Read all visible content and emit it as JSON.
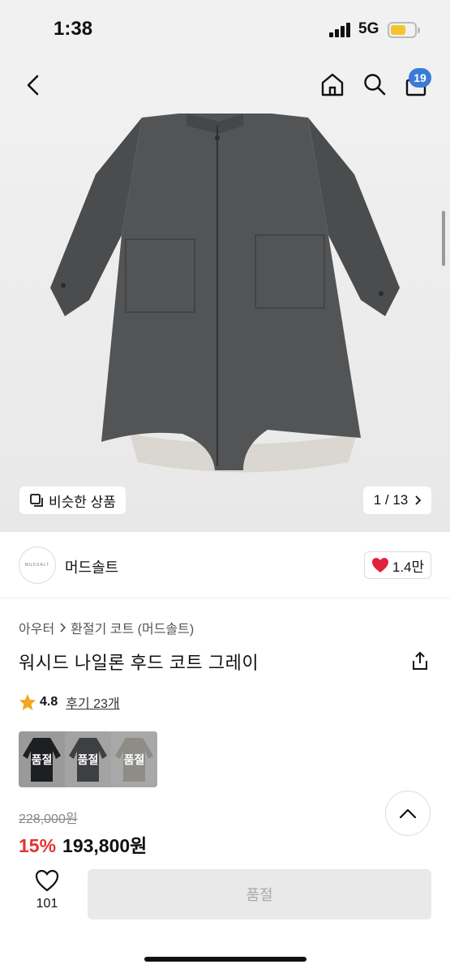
{
  "status_bar": {
    "time": "1:38",
    "network": "5G"
  },
  "nav": {
    "cart_count": "19"
  },
  "gallery": {
    "similar_label": "비슷한 상품",
    "pager": "1 / 13"
  },
  "brand": {
    "name": "머드솔트",
    "logo_text": "MUDSALT",
    "likes": "1.4만"
  },
  "breadcrumb": {
    "items": [
      "아우터",
      "환절기 코트 (머드솔트)"
    ]
  },
  "product": {
    "title": "워시드 나일론 후드 코트 그레이",
    "rating": "4.8",
    "reviews": "후기 23개",
    "original_price": "228,000원",
    "discount": "15%",
    "price": "193,800원"
  },
  "variants": [
    {
      "label": "품절",
      "color": "#1e1f22"
    },
    {
      "label": "품절",
      "color": "#3d3f42"
    },
    {
      "label": "품절",
      "color": "#8e8c86"
    }
  ],
  "bottom": {
    "wish_count": "101",
    "soldout_label": "품절"
  },
  "colors": {
    "accent": "#3a7bd5",
    "discount": "#e3342f",
    "heart": "#e0233a",
    "star": "#f2a71c"
  }
}
